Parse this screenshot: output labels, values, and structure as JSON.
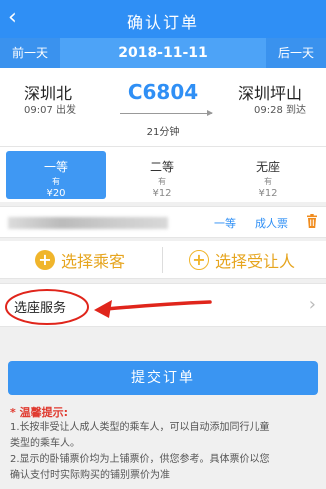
{
  "header": {
    "title": "确认订单",
    "back_icon": "chevron-left-icon"
  },
  "datebar": {
    "prev": "前一天",
    "date": "2018-11-11",
    "next": "后一天"
  },
  "train": {
    "number": "C6804",
    "from": {
      "station": "深圳北",
      "time": "09:07 出发"
    },
    "to": {
      "station": "深圳坪山",
      "time": "09:28 到达"
    },
    "duration": "21分钟"
  },
  "seats": [
    {
      "name": "一等",
      "avail": "有",
      "price": "¥20",
      "selected": true
    },
    {
      "name": "二等",
      "avail": "有",
      "price": "¥12",
      "selected": false
    },
    {
      "name": "无座",
      "avail": "有",
      "price": "¥12",
      "selected": false
    }
  ],
  "passenger": {
    "seat_class": "一等",
    "ticket_type": "成人票"
  },
  "actions": {
    "add_passenger": "选择乘客",
    "add_transferee": "选择受让人"
  },
  "seat_service": {
    "label": "选座服务"
  },
  "submit": {
    "label": "提交订单"
  },
  "tips": {
    "title": "* 温馨提示:",
    "lines": [
      "1.长按非受让人成人类型的乘车人，可以自动添加同行儿童",
      "类型的乘车人。",
      "2.显示的卧铺票价均为上铺票价，供您参考。具体票价以您",
      "确认支付时实际购买的铺别票价为准"
    ]
  },
  "colors": {
    "primary": "#2f8ff5",
    "accent": "#f0b52b",
    "annotation": "#e0251b"
  }
}
